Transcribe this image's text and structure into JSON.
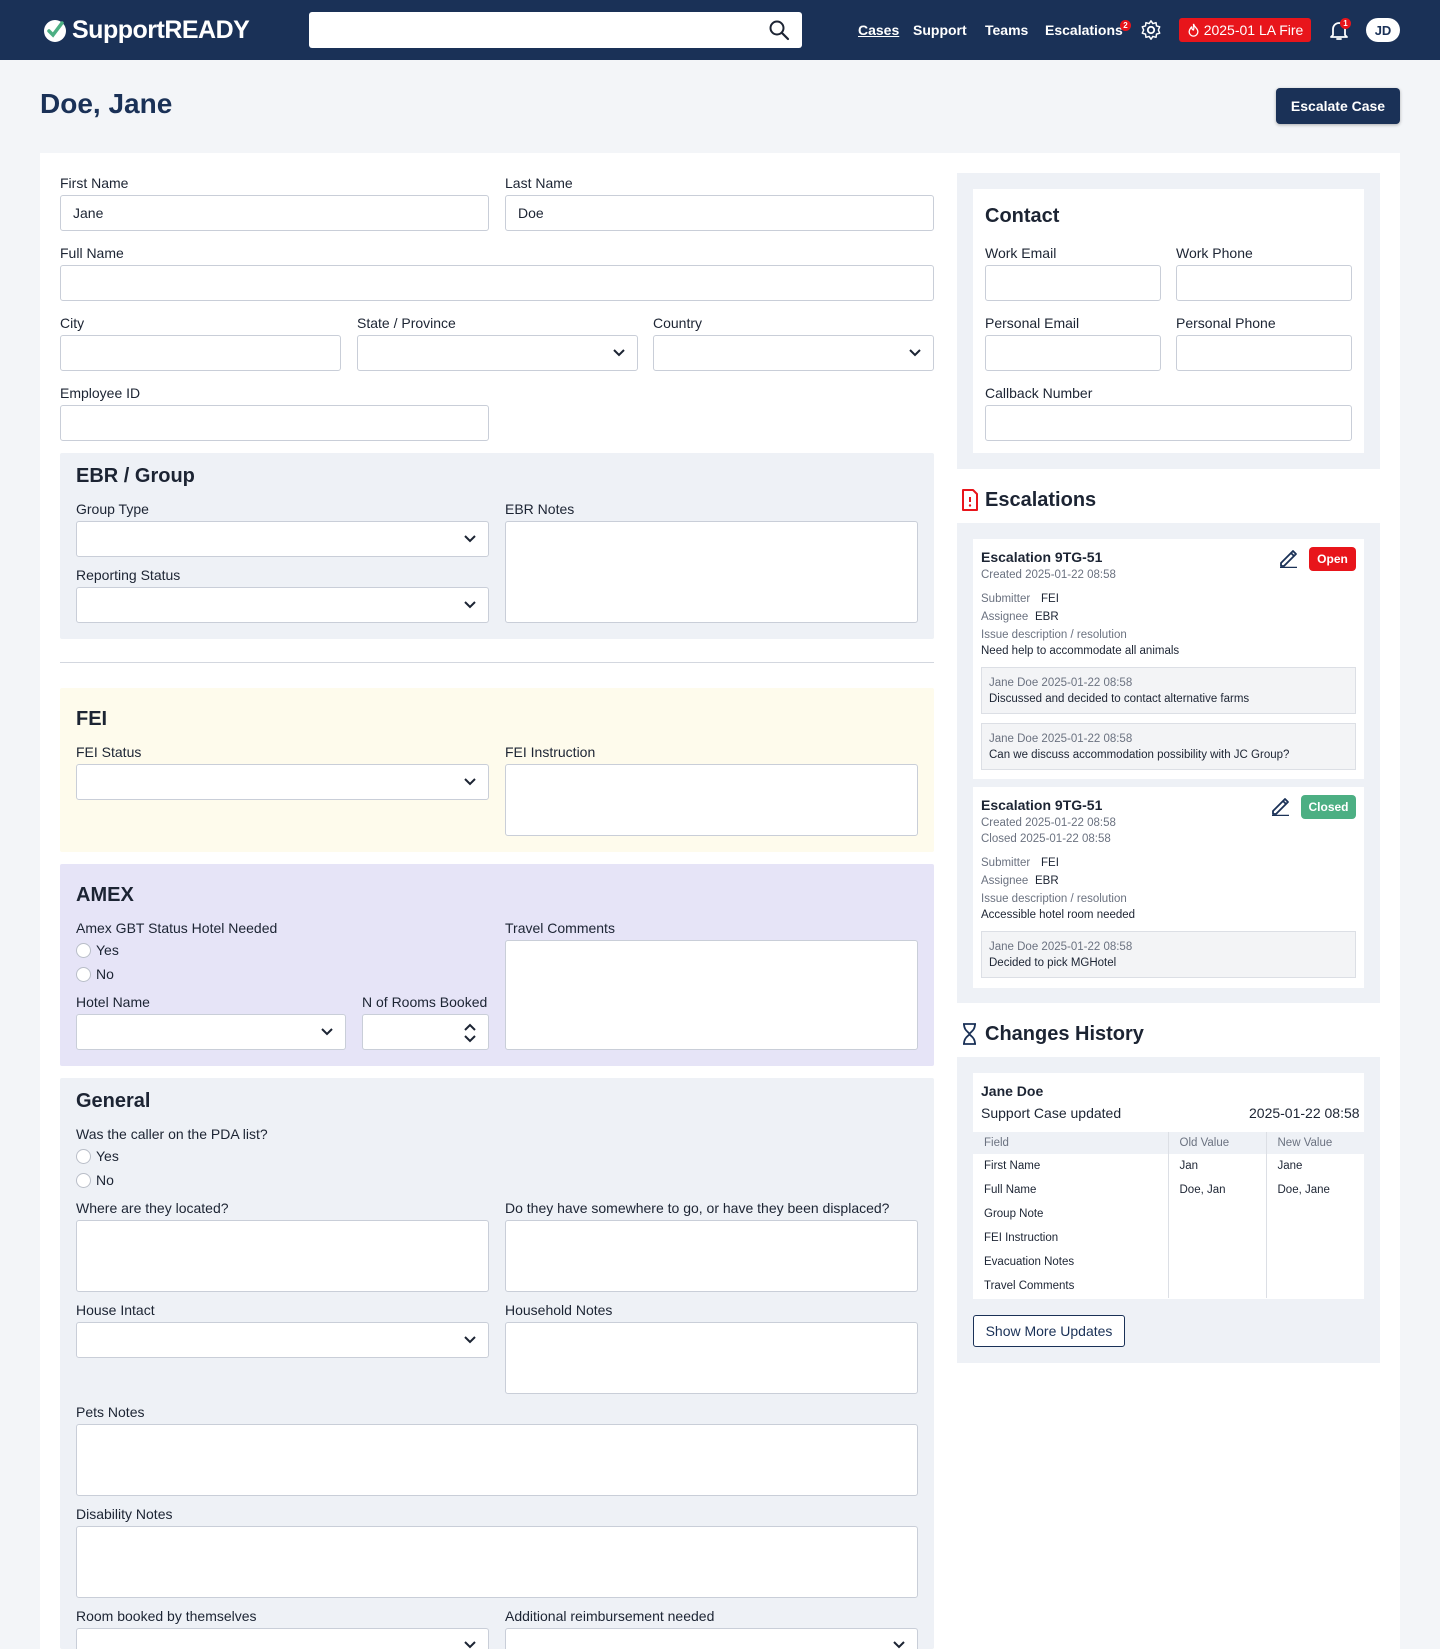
{
  "header": {
    "brand": "SupportREADY",
    "search_placeholder": "",
    "nav": [
      "Cases",
      "Support",
      "Teams",
      "Escalations"
    ],
    "escalations_badge": "2",
    "event_label": "2025-01 LA Fire",
    "notifications_badge": "1",
    "avatar_initials": "JD",
    "colors": {
      "primary": "#1a3157",
      "alert": "#e8151b"
    }
  },
  "page": {
    "title": "Doe, Jane",
    "escalate_label": "Escalate Case"
  },
  "form": {
    "first_name_label": "First Name",
    "first_name_value": "Jane",
    "last_name_label": "Last Name",
    "last_name_value": "Doe",
    "full_name_label": "Full Name",
    "city_label": "City",
    "state_label": "State / Province",
    "country_label": "Country",
    "employee_id_label": "Employee ID",
    "ebr": {
      "title": "EBR / Group",
      "group_type_label": "Group Type",
      "reporting_status_label": "Reporting Status",
      "notes_label": "EBR Notes",
      "bg": "#eef1f6"
    },
    "fei": {
      "title": "FEI",
      "status_label": "FEI Status",
      "instruction_label": "FEI Instruction",
      "bg": "#fefbec"
    },
    "amex": {
      "title": "AMEX",
      "hotel_needed_label": "Amex GBT Status Hotel Needed",
      "yes": "Yes",
      "no": "No",
      "hotel_name_label": "Hotel Name",
      "rooms_label": "N of Rooms Booked",
      "travel_comments_label": "Travel Comments",
      "bg": "#e6e4f7"
    },
    "general": {
      "title": "General",
      "pda_label": "Was the caller on the PDA list?",
      "yes": "Yes",
      "no": "No",
      "located_label": "Where are they located?",
      "displaced_label": "Do they have somewhere to go, or have they been displaced?",
      "house_label": "House Intact",
      "household_label": "Household Notes",
      "pets_label": "Pets Notes",
      "disability_label": "Disability Notes",
      "room_booked_label": "Room booked by themselves",
      "reimbursement_label": "Additional reimbursement needed",
      "bg": "#eef1f6"
    }
  },
  "contact": {
    "title": "Contact",
    "work_email": "Work Email",
    "work_phone": "Work Phone",
    "personal_email": "Personal Email",
    "personal_phone": "Personal Phone",
    "callback": "Callback Number"
  },
  "escalations": {
    "title": "Escalations",
    "items": [
      {
        "title": "Escalation 9TG-51",
        "status": "Open",
        "status_color": "#e8151b",
        "created": "Created 2025-01-22 08:58",
        "submitter_label": "Submitter",
        "submitter": "FEI",
        "assignee_label": "Assignee",
        "assignee": "EBR",
        "issue_label": "Issue description / resolution",
        "issue": "Need help to accommodate all animals",
        "comments": [
          {
            "meta": "Jane Doe  2025-01-22 08:58",
            "text": "Discussed and decided to contact alternative farms"
          },
          {
            "meta": "Jane Doe  2025-01-22 08:58",
            "text": "Can we discuss accommodation possibility with JC Group?"
          }
        ]
      },
      {
        "title": "Escalation 9TG-51",
        "status": "Closed",
        "status_color": "#4caf83",
        "created": "Created 2025-01-22 08:58",
        "closed": "Closed 2025-01-22 08:58",
        "submitter_label": "Submitter",
        "submitter": "FEI",
        "assignee_label": "Assignee",
        "assignee": "EBR",
        "issue_label": "Issue description / resolution",
        "issue": "Accessible hotel room needed",
        "comments": [
          {
            "meta": "Jane Doe  2025-01-22 08:58",
            "text": "Decided to pick MGHotel"
          }
        ]
      }
    ]
  },
  "history": {
    "title": "Changes History",
    "user": "Jane Doe",
    "action": "Support Case updated",
    "timestamp": "2025-01-22 08:58",
    "columns": [
      "Field",
      "Old Value",
      "New Value"
    ],
    "rows": [
      [
        "First Name",
        "Jan",
        "Jane"
      ],
      [
        "Full Name",
        "Doe, Jan",
        "Doe, Jane"
      ],
      [
        "Group Note",
        "",
        ""
      ],
      [
        "FEI Instruction",
        "",
        ""
      ],
      [
        "Evacuation Notes",
        "",
        ""
      ],
      [
        "Travel Comments",
        "",
        ""
      ]
    ],
    "more_label": "Show More Updates"
  }
}
